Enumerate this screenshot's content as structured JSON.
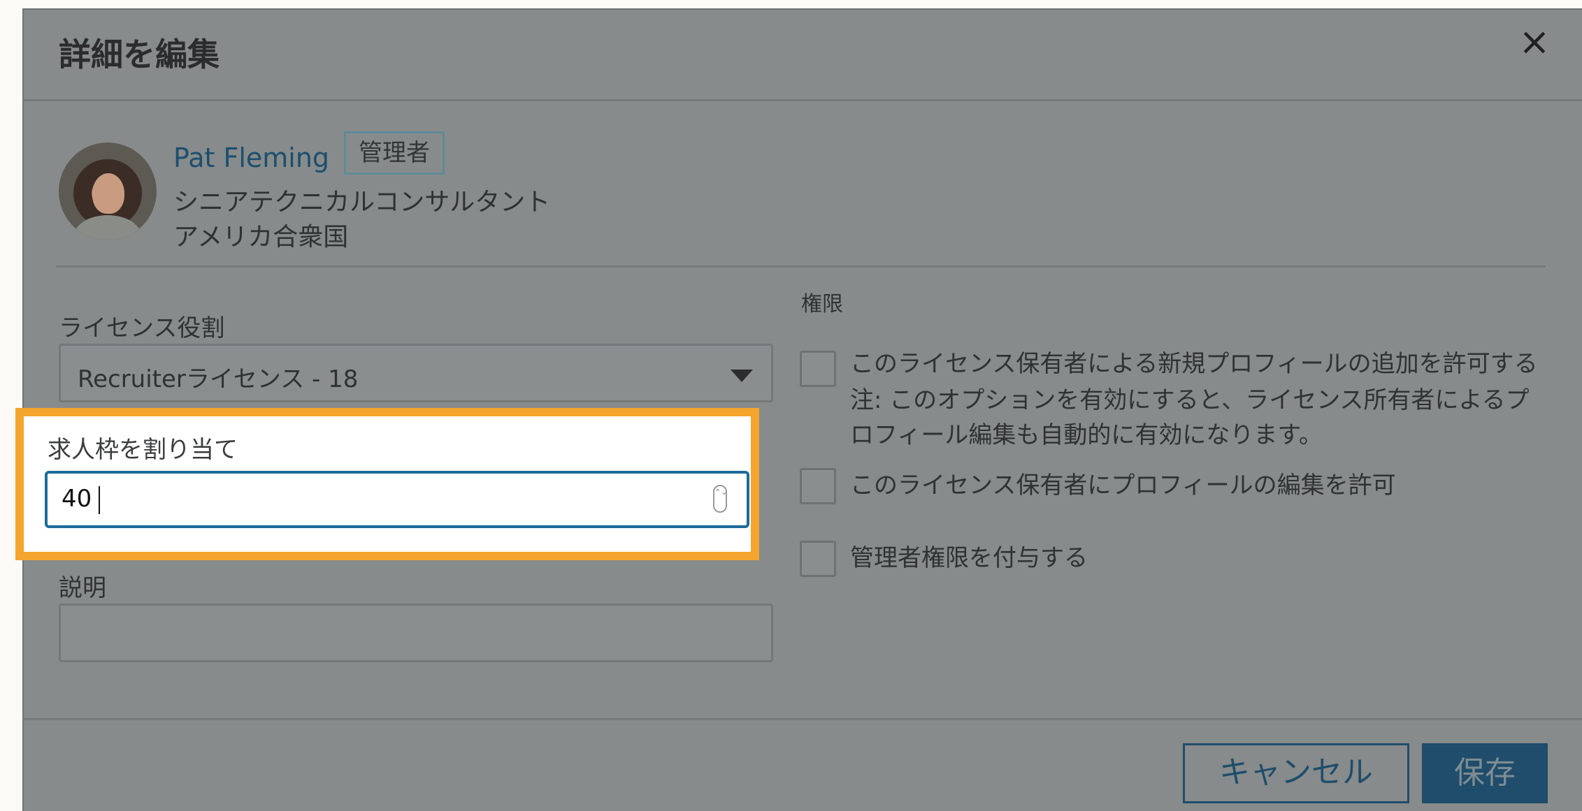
{
  "dialog": {
    "title": "詳細を編集",
    "close_icon": "×"
  },
  "profile": {
    "name": "Pat Fleming",
    "badge": "管理者",
    "job_title": "シニアテクニカルコンサルタント",
    "country": "アメリカ合衆国"
  },
  "license": {
    "label": "ライセンス役割",
    "selected": "Recruiterライセンス - 18"
  },
  "job_slots": {
    "label": "求人枠を割り当て",
    "value": "40",
    "spinner": "⌃⌄"
  },
  "description": {
    "label": "説明",
    "value": ""
  },
  "permissions": {
    "label": "権限",
    "items": [
      {
        "line1": "このライセンス保有者による新規プロフィールの追加を許可する",
        "line2": "注: このオプションを有効にすると、ライセンス所有者によるプ",
        "line3": "ロフィール編集も自動的に有効になります。",
        "checked": false
      },
      {
        "line1": "このライセンス保有者にプロフィールの編集を許可",
        "checked": false
      },
      {
        "line1": "管理者権限を付与する",
        "checked": false
      }
    ]
  },
  "footer": {
    "cancel_label": "キャンセル",
    "save_label": "保存"
  },
  "colors": {
    "overlay": "#888b8b",
    "highlight_border": "#f4a52d",
    "primary": "#1f4d6b",
    "input_focus": "#1d6b9a"
  }
}
